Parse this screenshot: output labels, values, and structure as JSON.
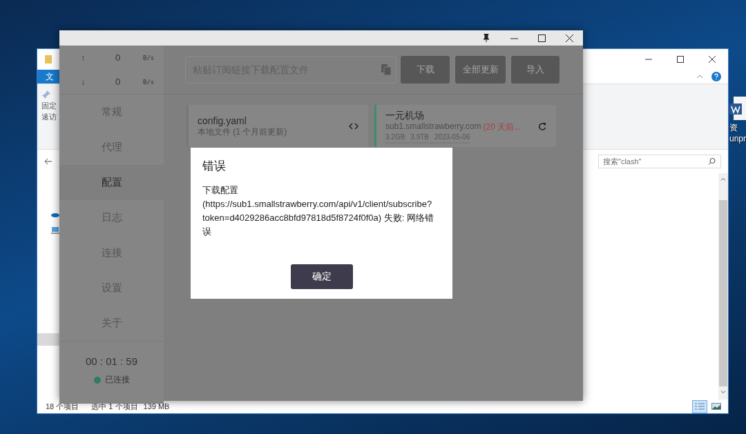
{
  "desktop_icon": {
    "label_lines": [
      "资",
      "unpr"
    ]
  },
  "explorer": {
    "ribbon_tab": "文",
    "pin_label_lines": [
      "固定",
      "速访"
    ],
    "search": {
      "placeholder": "搜索\"clash\""
    },
    "status_bar": {
      "count": "18 个项目",
      "selection": "选中 1 个项目",
      "size": "139 MB"
    },
    "view_buttons": [
      {
        "kind": "details",
        "selected": true
      },
      {
        "kind": "thumbnails",
        "selected": false
      }
    ]
  },
  "clash": {
    "traffic": [
      {
        "arrow": "↑",
        "value": "0",
        "unit": "B/s"
      },
      {
        "arrow": "↓",
        "value": "0",
        "unit": "B/s"
      }
    ],
    "nav": [
      {
        "label": "常规",
        "selected": false
      },
      {
        "label": "代理",
        "selected": false
      },
      {
        "label": "配置",
        "selected": true
      },
      {
        "label": "日志",
        "selected": false
      },
      {
        "label": "连接",
        "selected": false
      },
      {
        "label": "设置",
        "selected": false
      },
      {
        "label": "关于",
        "selected": false
      }
    ],
    "timer": "00 : 01 : 59",
    "status": {
      "label": "已连接",
      "color": "#2e7d5b"
    },
    "url_field": {
      "placeholder": "粘贴订阅链接下载配置文件"
    },
    "buttons": [
      "下载",
      "全部更新",
      "导入"
    ],
    "profiles": [
      {
        "kind": "local",
        "name": "config.yaml",
        "subtitle": "本地文件 (1 个月前更新)",
        "selected": false
      },
      {
        "kind": "remote",
        "name": "一元机场",
        "host": "sub1.smallstrawberry.com",
        "age": "(20 天前...",
        "stats": [
          "3.2GB",
          "3.9TB",
          "2023-05-06"
        ],
        "selected": true
      }
    ],
    "dialog": {
      "title": "错误",
      "message": "下载配置 (https://sub1.smallstrawberry.com/api/v1/client/subscribe?token=d4029286acc8bfd97818d5f8724f0f0a) 失败: 网络错误",
      "button": "确定"
    }
  }
}
